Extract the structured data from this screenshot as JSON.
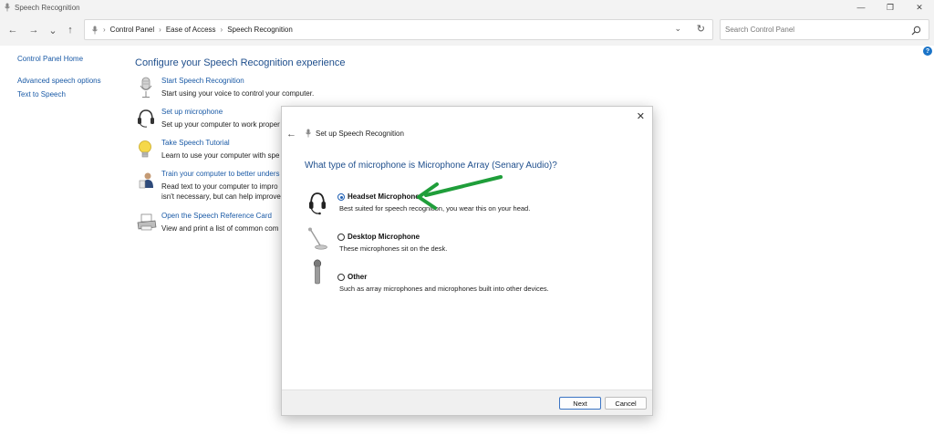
{
  "window": {
    "title": "Speech Recognition",
    "minimize_glyph": "—",
    "maximize_glyph": "❐",
    "close_glyph": "✕"
  },
  "nav": {
    "back_glyph": "←",
    "forward_glyph": "→",
    "recent_glyph": "⌄",
    "up_glyph": "↑",
    "breadcrumbs": [
      "Control Panel",
      "Ease of Access",
      "Speech Recognition"
    ],
    "separator": "›",
    "dropdown_glyph": "⌄",
    "refresh_glyph": "↻",
    "search_placeholder": "Search Control Panel"
  },
  "help": {
    "glyph": "?"
  },
  "left_nav": {
    "home": "Control Panel Home",
    "links": [
      "Advanced speech options",
      "Text to Speech"
    ]
  },
  "main": {
    "heading": "Configure your Speech Recognition experience",
    "tasks": [
      {
        "icon": "microphone-icon",
        "link": "Start Speech Recognition",
        "desc": [
          "Start using your voice to control your computer."
        ]
      },
      {
        "icon": "headset-icon",
        "link": "Set up microphone",
        "desc": [
          "Set up your computer to work proper"
        ]
      },
      {
        "icon": "lightbulb-icon",
        "link": "Take Speech Tutorial",
        "desc": [
          "Learn to use your computer with spe"
        ]
      },
      {
        "icon": "person-training-icon",
        "link": "Train your computer to better unders",
        "desc": [
          "Read text to your computer to impro",
          "isn't necessary, but can help improve"
        ]
      },
      {
        "icon": "printer-icon",
        "link": "Open the Speech Reference Card",
        "desc": [
          "View and print a list of common com"
        ]
      }
    ]
  },
  "dialog": {
    "close_glyph": "✕",
    "back_glyph": "←",
    "header": "Set up Speech Recognition",
    "question": "What type of microphone is Microphone Array (Senary Audio)?",
    "options": [
      {
        "label": "Headset Microphone",
        "desc": "Best suited for speech recognition, you wear this on your head.",
        "selected": true,
        "icon": "headset-microphone-icon"
      },
      {
        "label": "Desktop Microphone",
        "desc": "These microphones sit on the desk.",
        "selected": false,
        "icon": "desktop-microphone-icon"
      },
      {
        "label": "Other",
        "desc": "Such as array microphones and microphones built into other devices.",
        "selected": false,
        "icon": "handheld-microphone-icon"
      }
    ],
    "next_label": "Next",
    "cancel_label": "Cancel"
  },
  "colors": {
    "link": "#1a5aa6",
    "heading": "#1e4e8c",
    "annotation_arrow": "#1f9e3a"
  }
}
